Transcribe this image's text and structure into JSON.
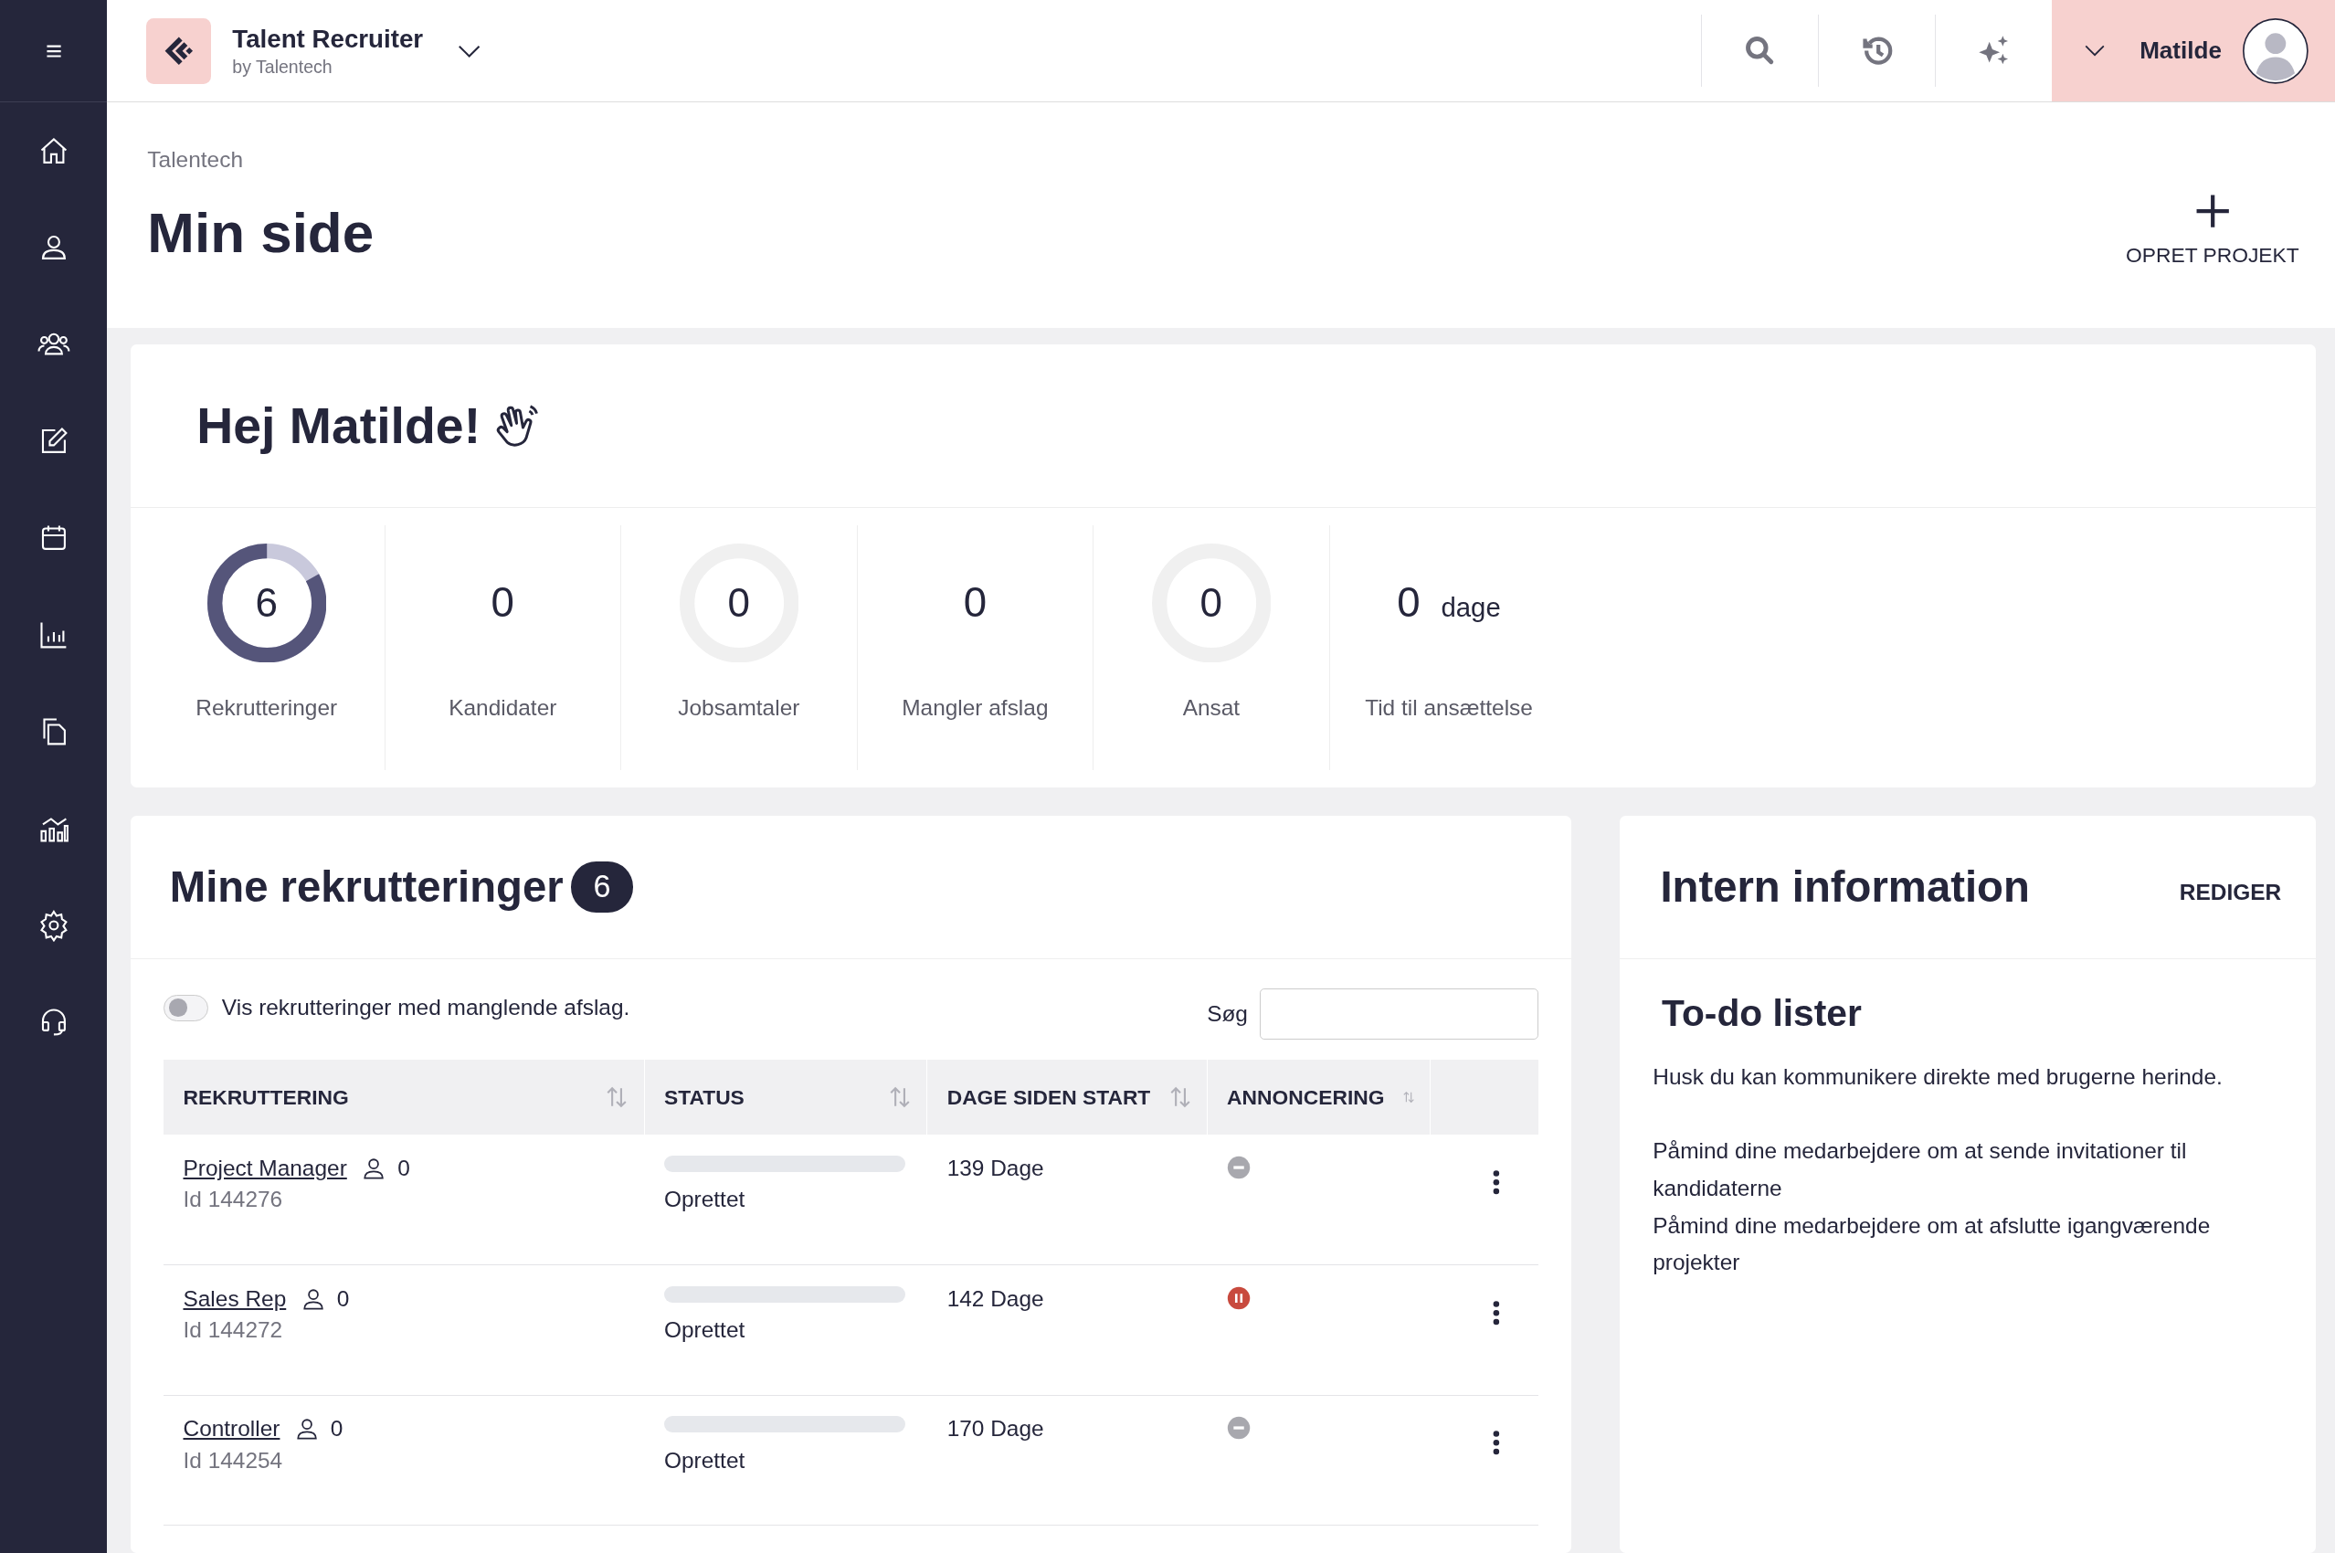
{
  "topbar": {
    "app_name": "Talent Recruiter",
    "app_subtitle": "by Talentech",
    "user_name": "Matilde"
  },
  "header": {
    "breadcrumb": "Talentech",
    "title": "Min side",
    "create_button": "OPRET PROJEKT"
  },
  "greeting": "Hej Matilde!",
  "stats": [
    {
      "kind": "ring",
      "value": "6",
      "label": "Rekrutteringer",
      "level": 0.83
    },
    {
      "kind": "plain",
      "value": "0",
      "label": "Kandidater"
    },
    {
      "kind": "ring",
      "value": "0",
      "label": "Jobsamtaler",
      "level": 0
    },
    {
      "kind": "plain",
      "value": "0",
      "label": "Mangler afslag"
    },
    {
      "kind": "ring",
      "value": "0",
      "label": "Ansat",
      "level": 0
    },
    {
      "kind": "unit",
      "value": "0",
      "unit": "dage",
      "label": "Tid til ansættelse"
    }
  ],
  "recruitments": {
    "title": "Mine rekrutteringer",
    "count": "6",
    "toggle": {
      "label": "Vis rekrutteringer med manglende afslag.",
      "on": false
    },
    "search_label": "Søg",
    "columns": [
      "REKRUTTERING",
      "STATUS",
      "DAGE SIDEN START",
      "ANNONCERING"
    ],
    "rows": [
      {
        "title": "Project Manager",
        "candidates": "0",
        "id": "Id 144276",
        "level": 0,
        "status": "Oprettet",
        "days": "139 Dage",
        "kind": "inactive"
      },
      {
        "title": "Sales Rep",
        "candidates": "0",
        "id": "Id 144272",
        "level": 0,
        "status": "Oprettet",
        "days": "142 Dage",
        "kind": "paused"
      },
      {
        "title": "Controller",
        "candidates": "0",
        "id": "Id 144254",
        "level": 0,
        "status": "Oprettet",
        "days": "170 Dage",
        "kind": "inactive"
      }
    ]
  },
  "intern": {
    "title": "Intern information",
    "edit_button": "REDIGER",
    "subtitle": "To-do lister",
    "paragraphs": [
      "Husk du kan kommunikere direkte med brugerne herinde.",
      "Påmind dine medarbejdere om at sende invitationer til kandidaterne",
      "Påmind dine medarbejdere om at afslutte igangværende projekter"
    ]
  }
}
